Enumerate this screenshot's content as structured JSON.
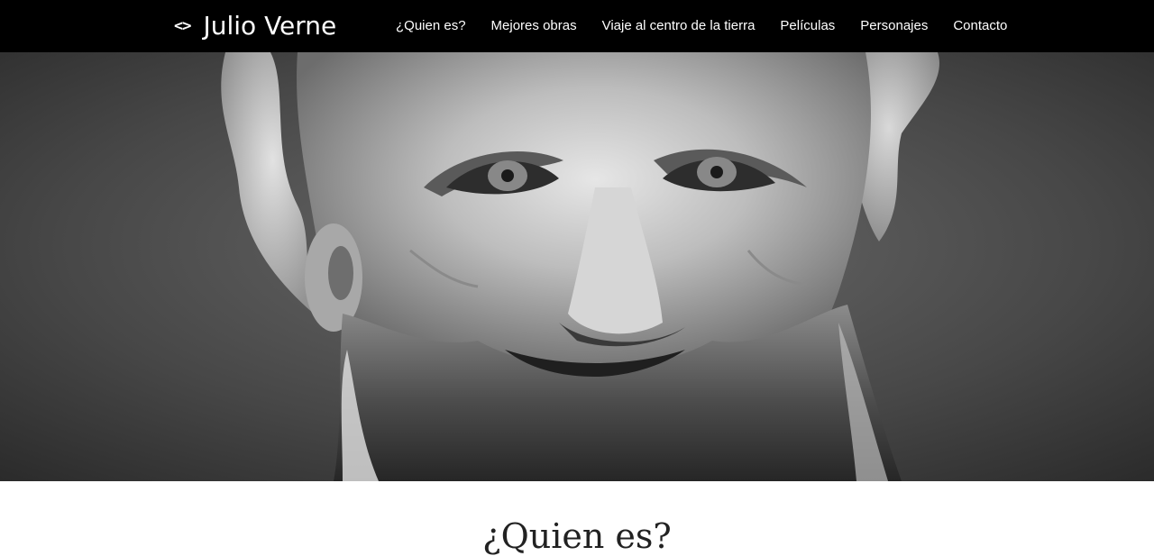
{
  "navbar": {
    "brand_icon": "<>",
    "brand_title": "Julio Verne",
    "links": [
      {
        "label": "¿Quien es?"
      },
      {
        "label": "Mejores obras"
      },
      {
        "label": "Viaje al centro de la tierra"
      },
      {
        "label": "Películas"
      },
      {
        "label": "Personajes"
      },
      {
        "label": "Contacto"
      }
    ]
  },
  "hero": {
    "image": "black-and-white portrait"
  },
  "section": {
    "title": "¿Quien es?"
  },
  "colors": {
    "navbar_bg": "#000000",
    "navbar_text": "#ffffff",
    "page_bg": "#ffffff",
    "title_text": "#222222"
  }
}
